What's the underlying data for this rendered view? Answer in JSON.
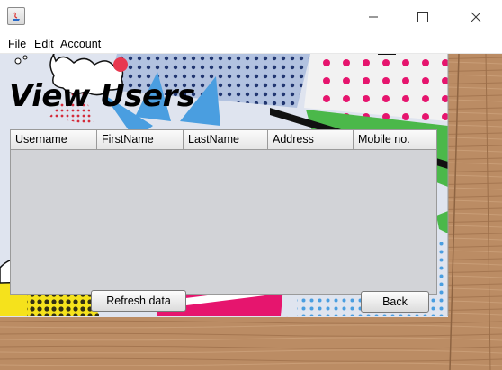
{
  "window": {
    "icon": "java-icon",
    "controls": [
      "minimize-icon",
      "maximize-icon",
      "close-icon"
    ]
  },
  "menu": {
    "items": [
      "File",
      "Edit",
      "Account"
    ]
  },
  "page": {
    "title": "View Users"
  },
  "table": {
    "columns": [
      "Username",
      "FirstName",
      "LastName",
      "Address",
      "Mobile no."
    ],
    "rows": []
  },
  "buttons": {
    "refresh": "Refresh data",
    "back": "Back"
  },
  "colors": {
    "wood": "#b98a62",
    "pop_blue": "#2b72d6",
    "pop_pink": "#e6156e",
    "pop_green": "#4bb84a",
    "pop_yellow": "#f5e21c",
    "table_bg": "#d2d3d7"
  }
}
